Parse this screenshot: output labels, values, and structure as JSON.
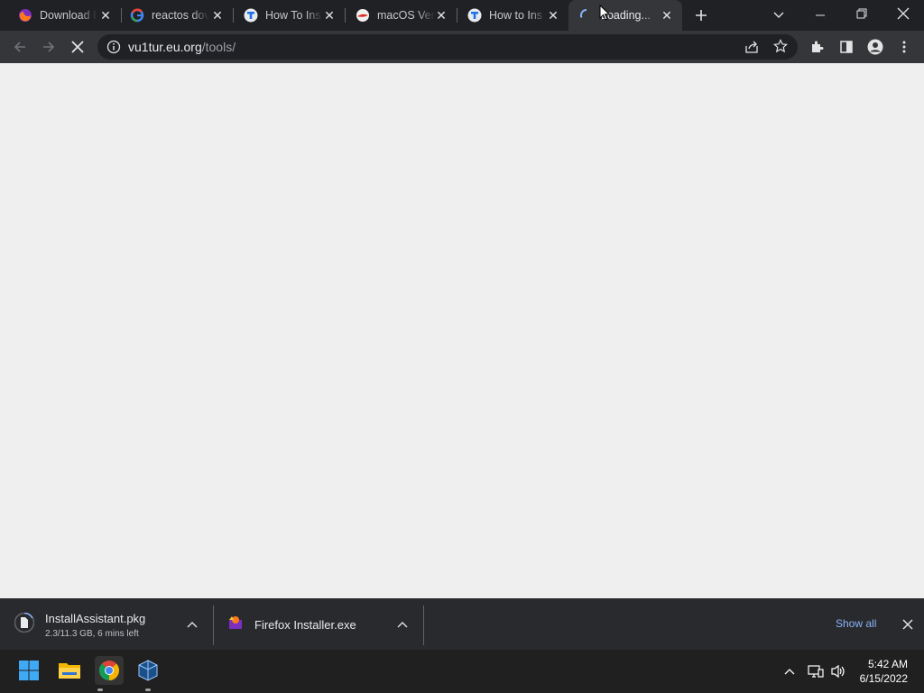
{
  "browser": {
    "tabs": [
      {
        "title": "Download I",
        "favicon": "firefox-icon"
      },
      {
        "title": "reactos dov",
        "favicon": "google-icon"
      },
      {
        "title": "How To Ins",
        "favicon": "t-logo-icon"
      },
      {
        "title": "macOS Ven",
        "favicon": "macos-icon"
      },
      {
        "title": "How to Ins",
        "favicon": "t-logo-icon"
      },
      {
        "title": "Loading...",
        "favicon": "loading-spinner-icon"
      }
    ],
    "url_host": "vu1tur.eu.org",
    "url_path": "/tools/"
  },
  "downloads": {
    "items": [
      {
        "name": "InstallAssistant.pkg",
        "status": "2.3/11.3 GB, 6 mins left"
      },
      {
        "name": "Firefox Installer.exe",
        "status": ""
      }
    ],
    "show_all_label": "Show all"
  },
  "taskbar": {
    "time": "5:42 AM",
    "date": "6/15/2022"
  },
  "colors": {
    "tabstrip": "#202124",
    "toolbar": "#35363a",
    "content": "#efefef",
    "link": "#8ab4f8"
  }
}
